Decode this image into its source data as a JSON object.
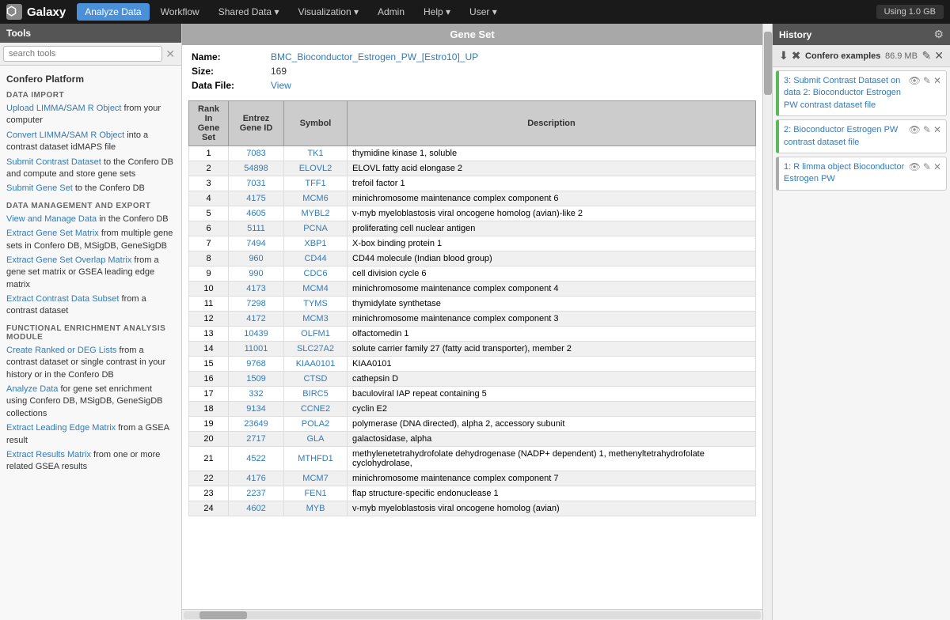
{
  "navbar": {
    "brand": "Galaxy",
    "using": "Using 1.0 GB",
    "nav_items": [
      {
        "label": "Analyze Data",
        "active": true
      },
      {
        "label": "Workflow",
        "active": false
      },
      {
        "label": "Shared Data",
        "active": false,
        "dropdown": true
      },
      {
        "label": "Visualization",
        "active": false,
        "dropdown": true
      },
      {
        "label": "Admin",
        "active": false
      },
      {
        "label": "Help",
        "active": false,
        "dropdown": true
      },
      {
        "label": "User",
        "active": false,
        "dropdown": true
      }
    ]
  },
  "sidebar": {
    "header": "Tools",
    "search_placeholder": "search tools",
    "platform_title": "Confero Platform",
    "sections": [
      {
        "title": "DATA IMPORT",
        "items": [
          {
            "text": "Upload LIMMA/SAM R Object",
            "suffix": " from your computer"
          },
          {
            "text": "Convert LIMMA/SAM R Object",
            "suffix": " into a contrast dataset idMAPS file"
          },
          {
            "text": "Submit Contrast Dataset",
            "suffix": " to the Confero DB and compute and store gene sets"
          },
          {
            "text": "Submit Gene Set",
            "suffix": " to the Confero DB"
          }
        ]
      },
      {
        "title": "DATA MANAGEMENT AND EXPORT",
        "items": [
          {
            "text": "View and Manage Data",
            "suffix": " in the Confero DB"
          },
          {
            "text": "Extract Gene Set Matrix",
            "suffix": " from multiple gene sets in Confero DB, MSigDB, GeneSigDB"
          },
          {
            "text": "Extract Gene Set Overlap Matrix",
            "suffix": " from a gene set matrix or GSEA leading edge matrix"
          },
          {
            "text": "Extract Contrast Data Subset",
            "suffix": " from a contrast dataset"
          }
        ]
      },
      {
        "title": "FUNCTIONAL ENRICHMENT ANALYSIS MODULE",
        "items": [
          {
            "text": "Create Ranked or DEG Lists",
            "suffix": " from a contrast dataset or single contrast in your history or in the Confero DB"
          },
          {
            "text": "Analyze Data",
            "suffix": " for gene set enrichment using Confero DB, MSigDB, GeneSigDB collections"
          },
          {
            "text": "Extract Leading Edge Matrix",
            "suffix": " from a GSEA result"
          },
          {
            "text": "Extract Results Matrix",
            "suffix": " from one or more related GSEA results"
          }
        ]
      }
    ]
  },
  "gene_set": {
    "header": "Gene Set",
    "name_label": "Name:",
    "name_value": "BMC_Bioconductor_Estrogen_PW_[Estro10]_UP",
    "size_label": "Size:",
    "size_value": "169",
    "data_file_label": "Data File:",
    "data_file_link": "View",
    "table_headers": {
      "rank": "Rank In Gene Set",
      "entrez": "Entrez Gene ID",
      "symbol": "Symbol",
      "description": "Description"
    },
    "genes": [
      {
        "rank": 1,
        "entrez": "7083",
        "symbol": "TK1",
        "description": "thymidine kinase 1, soluble"
      },
      {
        "rank": 2,
        "entrez": "54898",
        "symbol": "ELOVL2",
        "description": "ELOVL fatty acid elongase 2"
      },
      {
        "rank": 3,
        "entrez": "7031",
        "symbol": "TFF1",
        "description": "trefoil factor 1"
      },
      {
        "rank": 4,
        "entrez": "4175",
        "symbol": "MCM6",
        "description": "minichromosome maintenance complex component 6"
      },
      {
        "rank": 5,
        "entrez": "4605",
        "symbol": "MYBL2",
        "description": "v-myb myeloblastosis viral oncogene homolog (avian)-like 2"
      },
      {
        "rank": 6,
        "entrez": "5111",
        "symbol": "PCNA",
        "description": "proliferating cell nuclear antigen"
      },
      {
        "rank": 7,
        "entrez": "7494",
        "symbol": "XBP1",
        "description": "X-box binding protein 1"
      },
      {
        "rank": 8,
        "entrez": "960",
        "symbol": "CD44",
        "description": "CD44 molecule (Indian blood group)"
      },
      {
        "rank": 9,
        "entrez": "990",
        "symbol": "CDC6",
        "description": "cell division cycle 6"
      },
      {
        "rank": 10,
        "entrez": "4173",
        "symbol": "MCM4",
        "description": "minichromosome maintenance complex component 4"
      },
      {
        "rank": 11,
        "entrez": "7298",
        "symbol": "TYMS",
        "description": "thymidylate synthetase"
      },
      {
        "rank": 12,
        "entrez": "4172",
        "symbol": "MCM3",
        "description": "minichromosome maintenance complex component 3"
      },
      {
        "rank": 13,
        "entrez": "10439",
        "symbol": "OLFM1",
        "description": "olfactomedin 1"
      },
      {
        "rank": 14,
        "entrez": "11001",
        "symbol": "SLC27A2",
        "description": "solute carrier family 27 (fatty acid transporter), member 2"
      },
      {
        "rank": 15,
        "entrez": "9768",
        "symbol": "KIAA0101",
        "description": "KIAA0101"
      },
      {
        "rank": 16,
        "entrez": "1509",
        "symbol": "CTSD",
        "description": "cathepsin D"
      },
      {
        "rank": 17,
        "entrez": "332",
        "symbol": "BIRC5",
        "description": "baculoviral IAP repeat containing 5"
      },
      {
        "rank": 18,
        "entrez": "9134",
        "symbol": "CCNE2",
        "description": "cyclin E2"
      },
      {
        "rank": 19,
        "entrez": "23649",
        "symbol": "POLA2",
        "description": "polymerase (DNA directed), alpha 2, accessory subunit"
      },
      {
        "rank": 20,
        "entrez": "2717",
        "symbol": "GLA",
        "description": "galactosidase, alpha"
      },
      {
        "rank": 21,
        "entrez": "4522",
        "symbol": "MTHFD1",
        "description": "methylenetetrahydrofolate dehydrogenase (NADP+ dependent) 1, methenyltetrahydrofolate cyclohydrolase,"
      },
      {
        "rank": 22,
        "entrez": "4176",
        "symbol": "MCM7",
        "description": "minichromosome maintenance complex component 7"
      },
      {
        "rank": 23,
        "entrez": "2237",
        "symbol": "FEN1",
        "description": "flap structure-specific endonuclease 1"
      },
      {
        "rank": 24,
        "entrez": "4602",
        "symbol": "MYB",
        "description": "v-myb myeloblastosis viral oncogene homolog (avian)"
      }
    ]
  },
  "history": {
    "title": "History",
    "gear_icon": "⚙",
    "items_icons": [
      "↓",
      "✖"
    ],
    "confero_name": "Confero examples",
    "confero_size": "86.9 MB",
    "history_items": [
      {
        "number": 3,
        "label": "3: Submit Contrast Dataset on data 2: Bioconductor Estrogen PW contrast dataset file",
        "color": "green",
        "actions": [
          "eye",
          "edit",
          "delete"
        ]
      },
      {
        "number": 2,
        "label": "2: Bioconductor Estrogen PW contrast dataset file",
        "color": "green",
        "actions": [
          "eye",
          "edit",
          "delete"
        ]
      },
      {
        "number": 1,
        "label": "1: R limma object Bioconductor Estrogen PW",
        "color": "gray",
        "actions": [
          "eye",
          "edit",
          "delete"
        ]
      }
    ]
  }
}
